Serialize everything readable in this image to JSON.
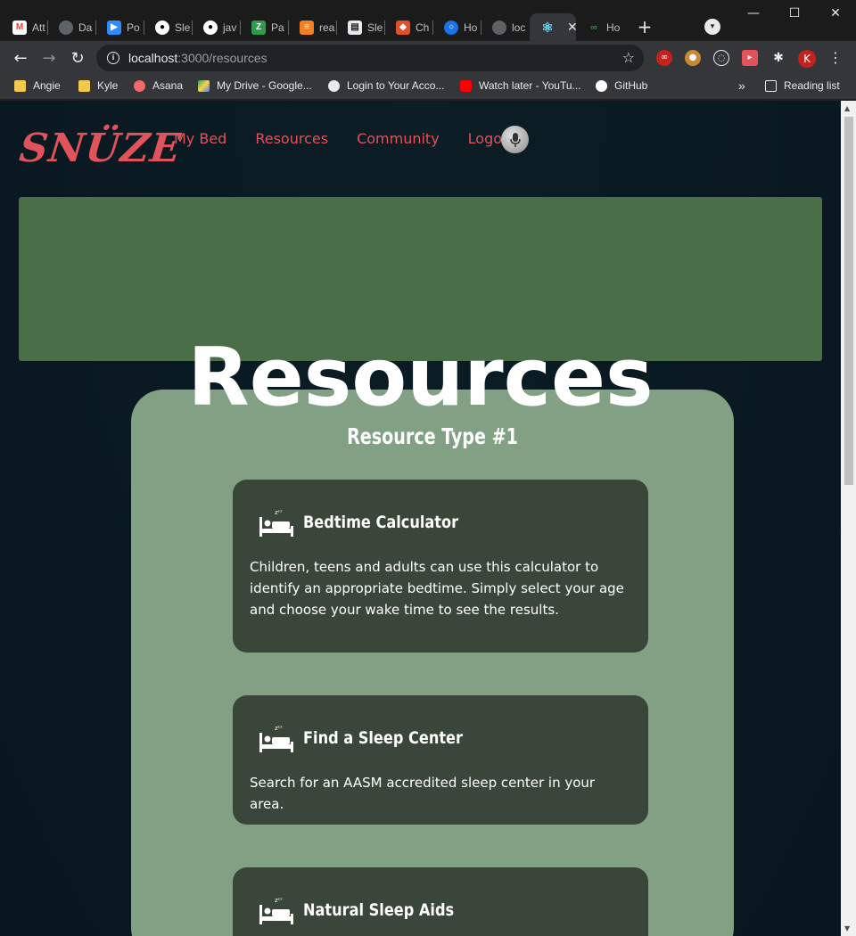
{
  "browser": {
    "tabs": [
      {
        "label": "Att",
        "icon": "gmail-icon",
        "color": "#ea4335"
      },
      {
        "label": "Da",
        "icon": "globe-icon",
        "color": "#9aa0a6"
      },
      {
        "label": "Po",
        "icon": "zoom-icon",
        "color": "#2d8cff"
      },
      {
        "label": "Sle",
        "icon": "github-icon",
        "color": "#ffffff"
      },
      {
        "label": "jav",
        "icon": "github-icon",
        "color": "#ffffff"
      },
      {
        "label": "Pa",
        "icon": "zb-icon",
        "color": "#2d9d4b"
      },
      {
        "label": "rea",
        "icon": "stackoverflow-icon",
        "color": "#f48024"
      },
      {
        "label": "Sle",
        "icon": "book-icon",
        "color": "#e8eaed"
      },
      {
        "label": "Ch",
        "icon": "cube-icon",
        "color": "#e34f26"
      },
      {
        "label": "Ho",
        "icon": "spinner-icon",
        "color": "#1a73e8"
      },
      {
        "label": "loc",
        "icon": "globe-icon",
        "color": "#9aa0a6"
      },
      {
        "label": "",
        "icon": "react-icon",
        "color": "#61dafb",
        "active": true
      },
      {
        "label": "Ho",
        "icon": "gg-icon",
        "color": "#2f8d46"
      }
    ],
    "url_host": "localhost",
    "url_path": ":3000/resources",
    "bookmarks": [
      {
        "label": "Angie",
        "icon": "folder-icon",
        "color": "#f2c94c"
      },
      {
        "label": "Kyle",
        "icon": "folder-icon",
        "color": "#f2c94c"
      },
      {
        "label": "Asana",
        "icon": "asana-icon",
        "color": "#f06a6a"
      },
      {
        "label": "My Drive - Google...",
        "icon": "drive-icon",
        "color": "#1fa463"
      },
      {
        "label": "Login to Your Acco...",
        "icon": "globe-icon",
        "color": "#e8eaed"
      },
      {
        "label": "Watch later - YouTu...",
        "icon": "youtube-icon",
        "color": "#ff0000"
      },
      {
        "label": "GitHub",
        "icon": "github-icon",
        "color": "#ffffff"
      }
    ],
    "overflow": "»",
    "reading_list": "Reading list",
    "profile_initial": "K"
  },
  "site": {
    "logo": "SNÜZE",
    "nav": [
      "My Bed",
      "Resources",
      "Community",
      "Logout"
    ],
    "page_title": "Resources",
    "section_title": "Resource Type #1",
    "resources": [
      {
        "title": "Bedtime Calculator",
        "desc": "Children, teens and adults can use this calculator to identify an appropriate bedtime. Simply select your age and choose your wake time to see the results."
      },
      {
        "title": "Find a Sleep Center",
        "desc": "Search for an AASM accredited sleep center in your area."
      },
      {
        "title": "Natural Sleep Aids",
        "desc": ""
      }
    ]
  },
  "colors": {
    "brand": "#e0535b",
    "banner": "#4a6e47",
    "panel": "#81a084",
    "card": "#394639"
  }
}
